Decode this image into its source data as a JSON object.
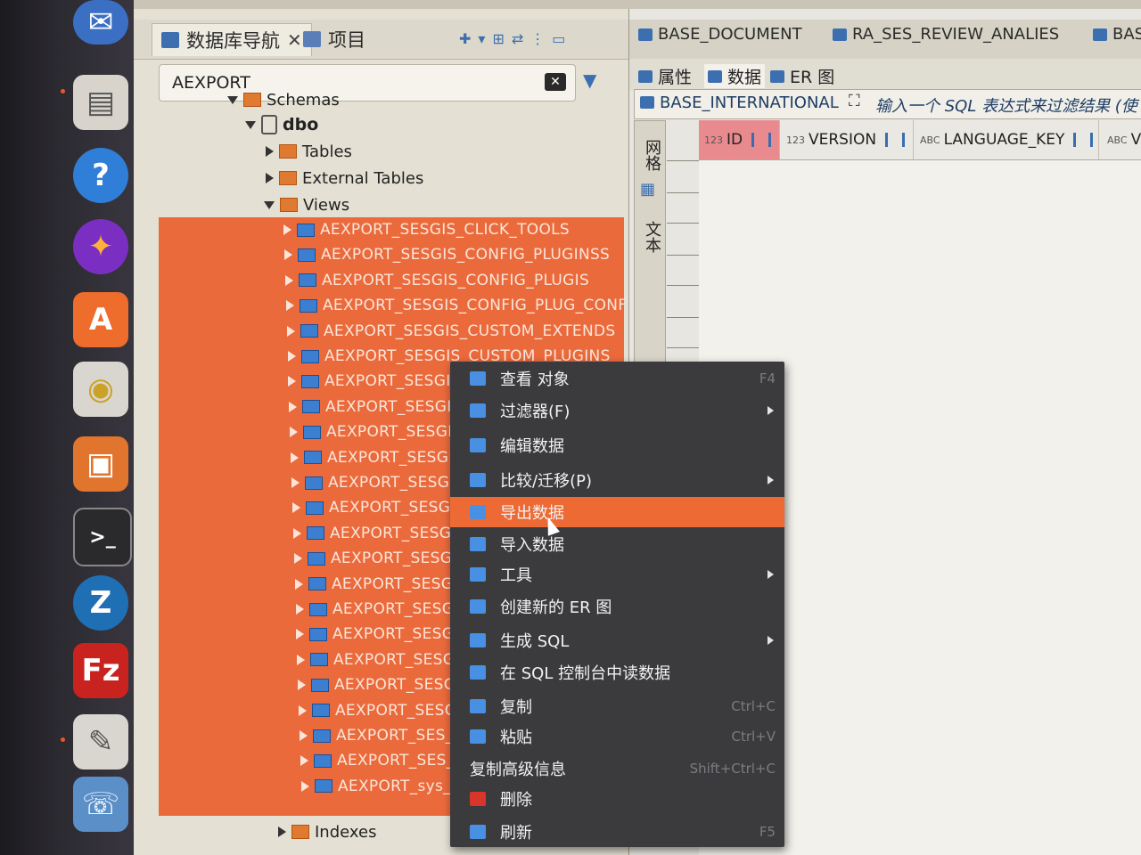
{
  "navigator": {
    "tab_navigator": "数据库导航",
    "tab_project": "项目",
    "filter_value": "AEXPORT",
    "tree": {
      "schemas": "Schemas",
      "dbo": "dbo",
      "tables": "Tables",
      "external_tables": "External Tables",
      "views": "Views",
      "indexes": "Indexes"
    },
    "views": [
      "AEXPORT_SESGIS_CLICK_TOOLS",
      "AEXPORT_SESGIS_CONFIG_PLUGINSS",
      "AEXPORT_SESGIS_CONFIG_PLUGIS",
      "AEXPORT_SESGIS_CONFIG_PLUG_CONFS",
      "AEXPORT_SESGIS_CUSTOM_EXTENDS",
      "AEXPORT_SESGIS_CUSTOM_PLUGINS",
      "AEXPORT_SESGIS",
      "AEXPORT_SESGIS",
      "AEXPORT_SESGIS",
      "AEXPORT_SESGIS",
      "AEXPORT_SESGIS",
      "AEXPORT_SESGIS",
      "AEXPORT_SESGIS",
      "AEXPORT_SESGIS",
      "AEXPORT_SESGIS",
      "AEXPORT_SESGIS",
      "AEXPORT_SESGIS",
      "AEXPORT_SESGIS",
      "AEXPORT_SESGIS",
      "AEXPORT_SESGIS",
      "AEXPORT_SES_B",
      "AEXPORT_SES_M",
      "AEXPORT_sys_co"
    ]
  },
  "editor": {
    "tabs": [
      "BASE_DOCUMENT",
      "RA_SES_REVIEW_ANALIES",
      "BAS"
    ],
    "subtabs": [
      "属性",
      "数据",
      "ER 图"
    ],
    "table_name": "BASE_INTERNATIONAL",
    "sql_filter_placeholder": "输入一个 SQL 表达式来过滤结果 (使",
    "side_labels": [
      "网格",
      "文本"
    ],
    "columns": [
      {
        "type": "123",
        "name": "ID"
      },
      {
        "type": "123",
        "name": "VERSION"
      },
      {
        "type": "ABC",
        "name": "LANGUAGE_KEY"
      },
      {
        "type": "ABC",
        "name": "V"
      }
    ]
  },
  "context_menu": {
    "items": [
      {
        "label": "查看 对象",
        "shortcut": "F4",
        "icon": "pencil-icon",
        "color": "#4a90e2"
      },
      {
        "label": "过滤器(F)",
        "shortcut": "",
        "icon": "filter-icon",
        "color": "#4a90e2",
        "submenu": true
      },
      {
        "label": "编辑数据",
        "shortcut": "",
        "icon": "table-edit-icon",
        "color": "#4a90e2"
      },
      {
        "label": "比较/迁移(P)",
        "shortcut": "",
        "icon": "compare-icon",
        "color": "#4a90e2",
        "submenu": true
      },
      {
        "label": "导出数据",
        "shortcut": "",
        "icon": "export-icon",
        "color": "#4a90e2",
        "highlight": true
      },
      {
        "label": "导入数据",
        "shortcut": "",
        "icon": "import-icon",
        "color": "#4a90e2"
      },
      {
        "label": "工具",
        "shortcut": "",
        "icon": "tools-icon",
        "color": "#4a90e2",
        "submenu": true
      },
      {
        "label": "创建新的 ER 图",
        "shortcut": "",
        "icon": "er-diagram-icon",
        "color": "#4a90e2"
      },
      {
        "label": "生成 SQL",
        "shortcut": "",
        "icon": "sql-icon",
        "color": "#4a90e2",
        "submenu": true
      },
      {
        "label": "在 SQL 控制台中读数据",
        "shortcut": "",
        "icon": "console-icon",
        "color": "#4a90e2"
      },
      {
        "label": "复制",
        "shortcut": "Ctrl+C",
        "icon": "copy-icon",
        "color": "#4a90e2"
      },
      {
        "label": "粘贴",
        "shortcut": "Ctrl+V",
        "icon": "paste-icon",
        "color": "#4a90e2"
      },
      {
        "label": "复制高级信息",
        "shortcut": "Shift+Ctrl+C",
        "icon": "",
        "color": ""
      },
      {
        "label": "删除",
        "shortcut": "",
        "icon": "delete-icon",
        "color": "#d9352b"
      },
      {
        "label": "刷新",
        "shortcut": "F5",
        "icon": "refresh-icon",
        "color": "#4a90e2"
      }
    ]
  },
  "dock": {
    "icons": [
      "mail-icon",
      "file-cabinet-icon",
      "help-icon",
      "browser-icon",
      "app-store-icon",
      "speaker-icon",
      "file-manager-icon",
      "terminal-icon",
      "app-icon",
      "filezilla-icon",
      "text-editor-icon",
      "phone-app-icon"
    ]
  }
}
